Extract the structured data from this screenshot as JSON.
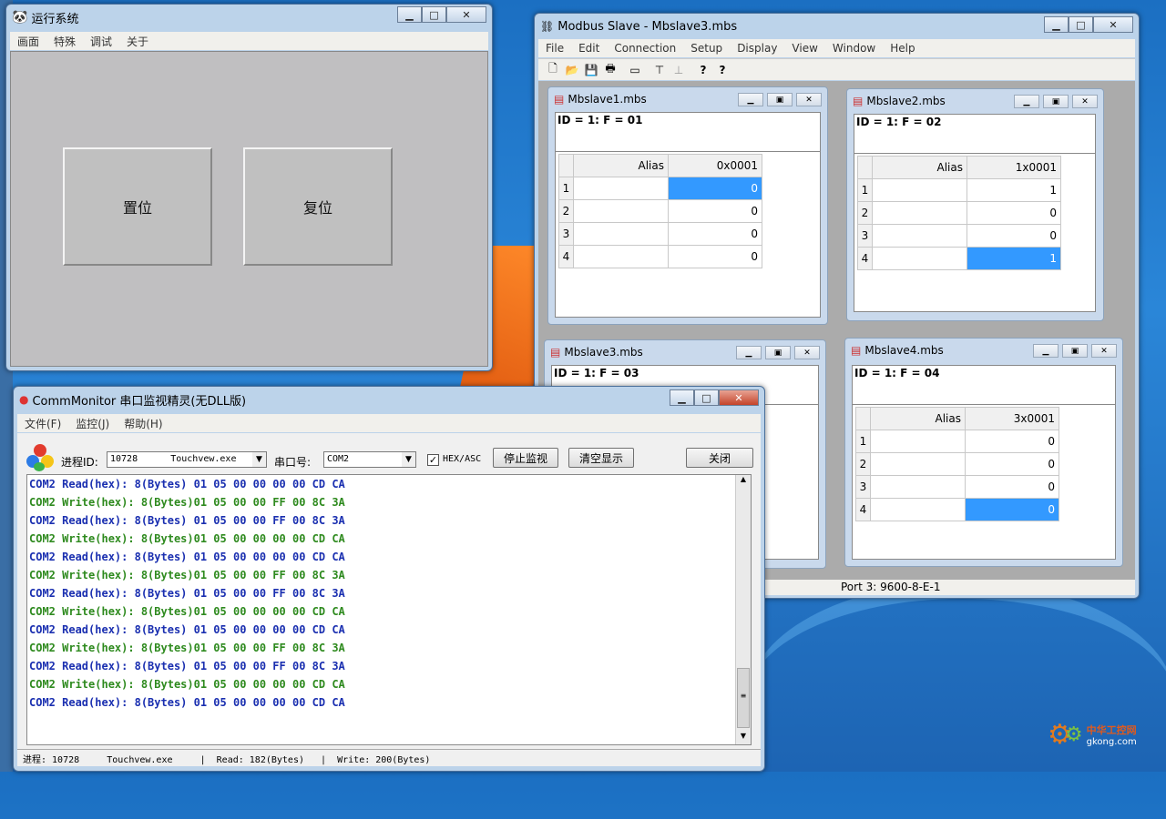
{
  "run_window": {
    "title": "运行系统",
    "menu": [
      "画面",
      "特殊",
      "调试",
      "关于"
    ],
    "set_button": "置位",
    "reset_button": "复位"
  },
  "modbus": {
    "title": "Modbus Slave - Mbslave3.mbs",
    "menu": [
      "File",
      "Edit",
      "Connection",
      "Setup",
      "Display",
      "View",
      "Window",
      "Help"
    ],
    "toolbar_icons": [
      "new-file-icon",
      "open-folder-icon",
      "save-icon",
      "print-icon",
      "window-icon",
      "connect-icon",
      "disconnect-icon",
      "help-icon",
      "context-help-icon"
    ],
    "toolbar_glyphs": [
      "🗋",
      "📂",
      "💾",
      "🖶",
      "▭",
      "⊤",
      "⊥",
      "?",
      "?"
    ],
    "status": "Port 3: 9600-8-E-1",
    "children": [
      {
        "title": "Mbslave1.mbs",
        "id_line": "ID = 1: F = 01",
        "alias_header": "Alias",
        "addr_header": "0x0001",
        "rows": [
          "1",
          "2",
          "3",
          "4"
        ],
        "values": [
          "0",
          "0",
          "0",
          "0"
        ],
        "selected": 0
      },
      {
        "title": "Mbslave2.mbs",
        "id_line": "ID = 1: F = 02",
        "alias_header": "Alias",
        "addr_header": "1x0001",
        "rows": [
          "1",
          "2",
          "3",
          "4"
        ],
        "values": [
          "1",
          "0",
          "0",
          "1"
        ],
        "selected": 3
      },
      {
        "title": "Mbslave3.mbs",
        "id_line": "ID = 1: F = 03"
      },
      {
        "title": "Mbslave4.mbs",
        "id_line": "ID = 1: F = 04",
        "alias_header": "Alias",
        "addr_header": "3x0001",
        "rows": [
          "1",
          "2",
          "3",
          "4"
        ],
        "values": [
          "0",
          "0",
          "0",
          "0"
        ],
        "selected": 3
      }
    ]
  },
  "comm": {
    "title": "CommMonitor 串口监视精灵(无DLL版)",
    "menu": [
      "文件(F)",
      "监控(J)",
      "帮助(H)"
    ],
    "pid_label": "进程ID:",
    "pid_value": "10728      Touchvew.exe",
    "port_label": "串口号:",
    "port_value": "COM2",
    "hex_label": "HEX/ASC",
    "stop_button": "停止监视",
    "clear_button": "清空显示",
    "close_button": "关闭",
    "log": [
      {
        "t": "r",
        "text": "COM2 Read(hex): 8(Bytes) 01 05 00 00 00 00 CD CA"
      },
      {
        "t": "w",
        "text": "COM2 Write(hex): 8(Bytes)01 05 00 00 FF 00 8C 3A"
      },
      {
        "t": "r",
        "text": "COM2 Read(hex): 8(Bytes) 01 05 00 00 FF 00 8C 3A"
      },
      {
        "t": "w",
        "text": "COM2 Write(hex): 8(Bytes)01 05 00 00 00 00 CD CA"
      },
      {
        "t": "r",
        "text": "COM2 Read(hex): 8(Bytes) 01 05 00 00 00 00 CD CA"
      },
      {
        "t": "w",
        "text": "COM2 Write(hex): 8(Bytes)01 05 00 00 FF 00 8C 3A"
      },
      {
        "t": "r",
        "text": "COM2 Read(hex): 8(Bytes) 01 05 00 00 FF 00 8C 3A"
      },
      {
        "t": "w",
        "text": "COM2 Write(hex): 8(Bytes)01 05 00 00 00 00 CD CA"
      },
      {
        "t": "r",
        "text": "COM2 Read(hex): 8(Bytes) 01 05 00 00 00 00 CD CA"
      },
      {
        "t": "w",
        "text": "COM2 Write(hex): 8(Bytes)01 05 00 00 FF 00 8C 3A"
      },
      {
        "t": "r",
        "text": "COM2 Read(hex): 8(Bytes) 01 05 00 00 FF 00 8C 3A"
      },
      {
        "t": "w",
        "text": "COM2 Write(hex): 8(Bytes)01 05 00 00 00 00 CD CA"
      },
      {
        "t": "r",
        "text": "COM2 Read(hex): 8(Bytes) 01 05 00 00 00 00 CD CA"
      }
    ],
    "status": "进程: 10728     Touchvew.exe     |  Read: 182(Bytes)   |  Write: 200(Bytes)"
  },
  "watermark": {
    "line1": "中华工控网",
    "line2": "gkong.com"
  }
}
